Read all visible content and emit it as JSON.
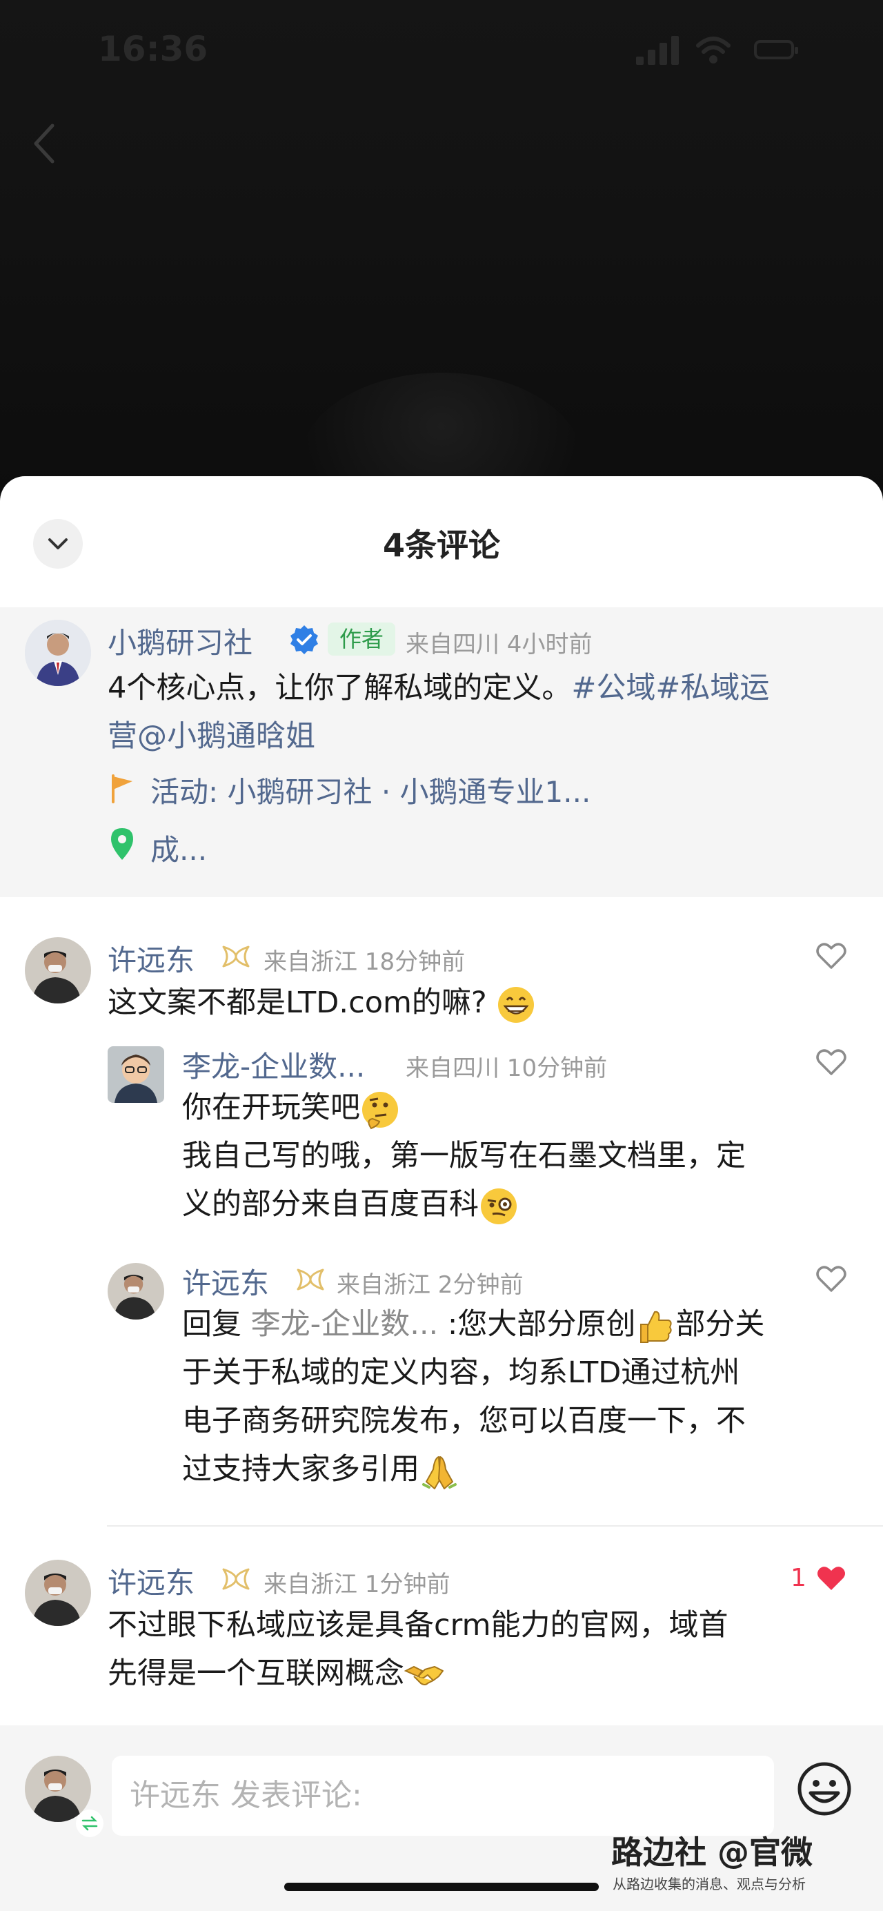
{
  "status_bar": {
    "time": "16:36"
  },
  "sheet": {
    "title": "4条评论"
  },
  "author_post": {
    "name": "小鹅研习社",
    "tag": "作者",
    "meta": "来自四川 4小时前",
    "text_plain": "4个核心点，让你了解私域的定义。",
    "hashtags": "#公域#私域运",
    "text_line2": "营@小鹅通晗姐",
    "activity": "活动: 小鹅研习社 · 小鹅通专业1...",
    "location": "成..."
  },
  "comments": [
    {
      "name": "许远东",
      "meta": "来自浙江 18分钟前",
      "text": "这文案不都是LTD.com的嘛?",
      "emoji": "grin-emoji"
    },
    {
      "name": "李龙-企业数...",
      "meta": "来自四川 10分钟前",
      "line1": "你在开玩笑吧",
      "line2": "我自己写的哦，第一版写在石墨文档里，定",
      "line3": "义的部分来自百度百科"
    },
    {
      "name": "许远东",
      "meta": "来自浙江 2分钟前",
      "reply_prefix": "回复",
      "reply_to": "李龙-企业数...",
      "line1_rest": ":您大部分原创",
      "line1_tail": "部分关",
      "line2": "于关于私域的定义内容，均系LTD通过杭州",
      "line3": "电子商务研究院发布，您可以百度一下，不",
      "line4": "过支持大家多引用"
    },
    {
      "name": "许远东",
      "meta": "来自浙江 1分钟前",
      "like_count": "1",
      "line1": "不过眼下私域应该是具备crm能力的官网，域首",
      "line2": "先得是一个互联网概念"
    }
  ],
  "input": {
    "placeholder": "许远东 发表评论:"
  },
  "watermark": {
    "title": "路边社 @官微",
    "subtitle": "从路边收集的消息、观点与分析"
  },
  "colors": {
    "name_blue": "#52688e",
    "like_red": "#f0334f",
    "author_tag_green": "#2d9b4a",
    "gold_badge": "#e2bf6a"
  }
}
